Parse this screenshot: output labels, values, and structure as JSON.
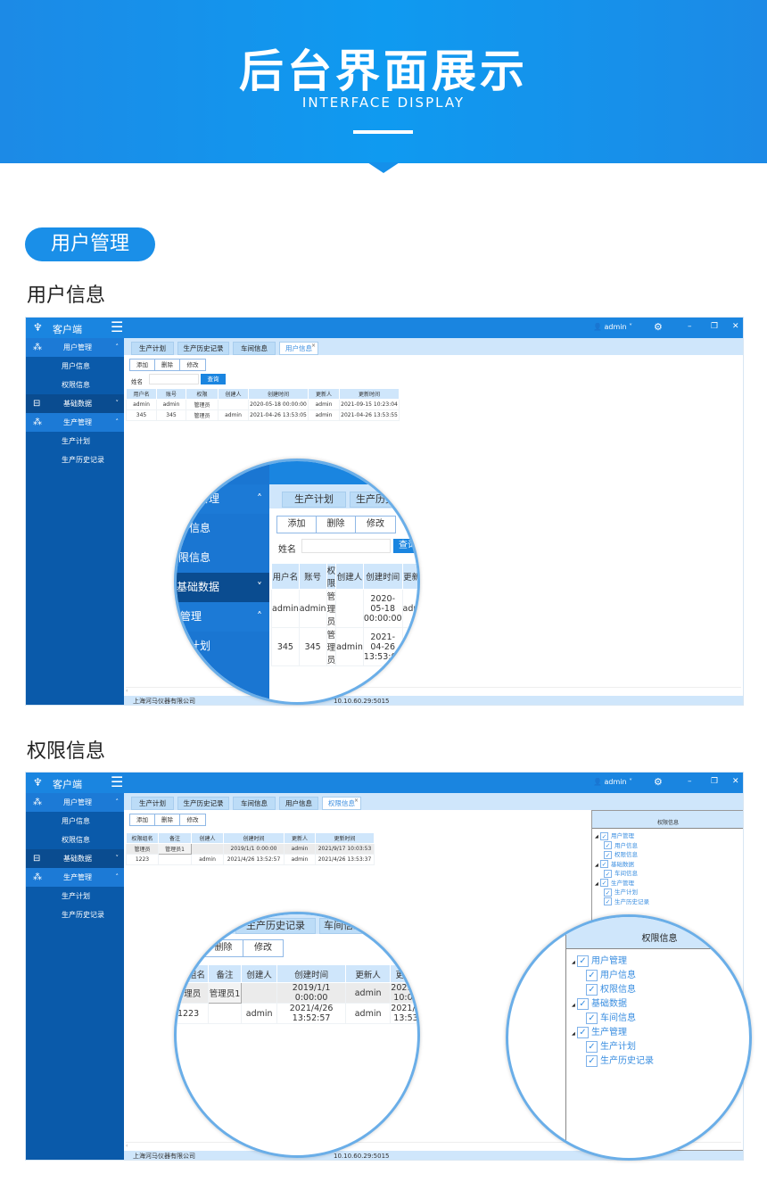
{
  "banner": {
    "title": "后台界面展示",
    "subtitle": "INTERFACE DISPLAY"
  },
  "section_pill": "用户管理",
  "section1_title": "用户信息",
  "section2_title": "权限信息",
  "colors": {
    "brand": "#1a85e0",
    "sidebar": "#0a5aaa",
    "sidebar_group": "#1c7ad6",
    "tabbar": "#cfe6fb",
    "link": "#3a8ee0"
  },
  "app": {
    "name": "客户端",
    "user": "admin",
    "icons": {
      "logo": "logo-icon",
      "menu": "hamburger-icon",
      "user": "user-icon",
      "settings": "gear-icon",
      "minimize": "minimize-icon",
      "restore": "restore-icon",
      "close": "close-icon"
    },
    "sidebar": [
      {
        "label": "用户管理",
        "type": "group",
        "icon": "users-icon",
        "caret": "˄"
      },
      {
        "label": "用户信息",
        "type": "sub"
      },
      {
        "label": "权限信息",
        "type": "sub"
      },
      {
        "label": "基础数据",
        "type": "dark",
        "icon": "box-icon",
        "caret": "˅"
      },
      {
        "label": "生产管理",
        "type": "group",
        "icon": "users-icon",
        "caret": "˄"
      },
      {
        "label": "生产计划",
        "type": "sub"
      },
      {
        "label": "生产历史记录",
        "type": "sub"
      }
    ],
    "toolbar": {
      "add": "添加",
      "delete": "删除",
      "edit": "修改",
      "name_label": "姓名",
      "name_value": "",
      "query": "查询"
    },
    "status": {
      "company": "上海河马仪器有限公司",
      "ip": "10.10.60.29:5015"
    }
  },
  "screen1": {
    "tabs": [
      "生产计划",
      "生产历史记录",
      "车间信息",
      "用户信息"
    ],
    "active_tab": 3,
    "columns": [
      "用户名",
      "账号",
      "权限",
      "创建人",
      "创建时间",
      "更新人",
      "更新时间"
    ],
    "rows": [
      [
        "admin",
        "admin",
        "管理员",
        "",
        "2020-05-18 00:00:00",
        "admin",
        "2021-09-15 10:23:04"
      ],
      [
        "345",
        "345",
        "管理员",
        "admin",
        "2021-04-26 13:53:05",
        "admin",
        "2021-04-26 13:53:55"
      ]
    ]
  },
  "screen2": {
    "tabs": [
      "生产计划",
      "生产历史记录",
      "车间信息",
      "用户信息",
      "权限信息"
    ],
    "active_tab": 4,
    "columns": [
      "权限组名",
      "备注",
      "创建人",
      "创建时间",
      "更新人",
      "更新时间"
    ],
    "rows": [
      [
        "管理员",
        "管理员1",
        "",
        "2019/1/1 0:00:00",
        "admin",
        "2021/9/17 10:03:53"
      ],
      [
        "1223",
        "",
        "admin",
        "2021/4/26 13:52:57",
        "admin",
        "2021/4/26 13:53:37"
      ]
    ],
    "perm_panel_title": "权限信息",
    "tree": [
      {
        "label": "用户管理",
        "level": 0,
        "checked": true
      },
      {
        "label": "用户信息",
        "level": 1,
        "checked": true
      },
      {
        "label": "权限信息",
        "level": 1,
        "checked": true
      },
      {
        "label": "基础数据",
        "level": 0,
        "checked": true
      },
      {
        "label": "车间信息",
        "level": 1,
        "checked": true
      },
      {
        "label": "生产管理",
        "level": 0,
        "checked": true
      },
      {
        "label": "生产计划",
        "level": 1,
        "checked": true
      },
      {
        "label": "生产历史记录",
        "level": 1,
        "checked": true
      }
    ]
  }
}
